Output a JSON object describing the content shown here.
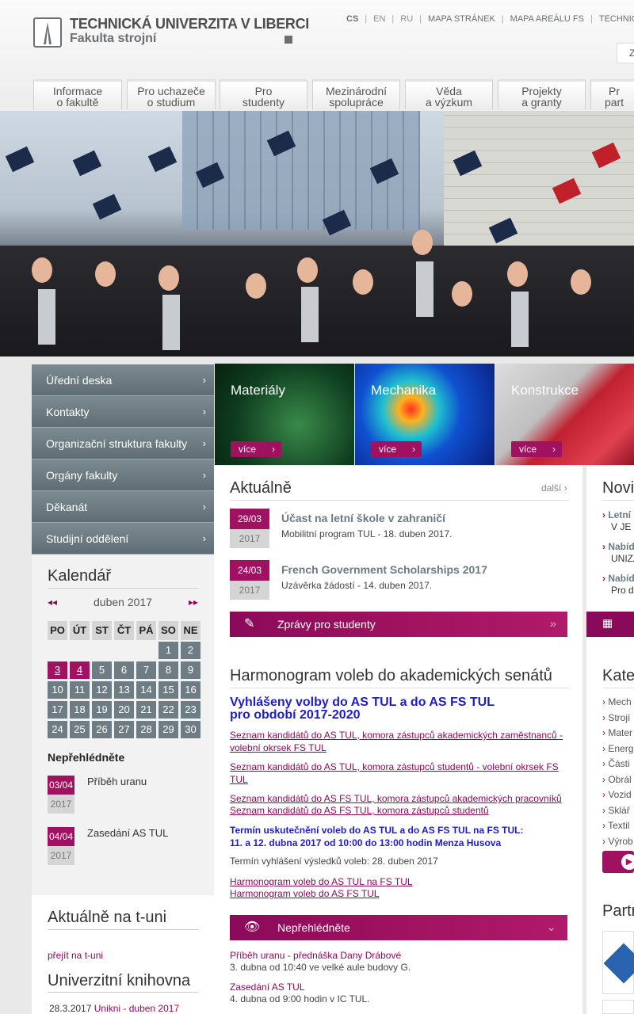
{
  "header": {
    "university": "TECHNICKÁ UNIVERZITA V LIBERCI",
    "faculty": "Fakulta strojní",
    "languages": [
      "CS",
      "EN",
      "RU"
    ],
    "links": [
      "MAPA STRÁNEK",
      "MAPA AREÁLU FS",
      "TECHNICKÁ"
    ],
    "search_partial": "Z"
  },
  "nav": {
    "tabs": [
      {
        "l1": "Informace",
        "l2": "o fakultě"
      },
      {
        "l1": "Pro uchazeče",
        "l2": "o studium"
      },
      {
        "l1": "Pro",
        "l2": "studenty"
      },
      {
        "l1": "Mezinárodní",
        "l2": "spolupráce"
      },
      {
        "l1": "Věda",
        "l2": "a výzkum"
      },
      {
        "l1": "Projekty",
        "l2": "a granty"
      },
      {
        "l1": "Pr",
        "l2": "part"
      }
    ]
  },
  "left_menu": [
    "Úřední deska",
    "Kontakty",
    "Organizační struktura fakulty",
    "Orgány fakulty",
    "Děkanát",
    "Studijní oddělení"
  ],
  "calendar": {
    "title": "Kalendář",
    "month": "duben 2017",
    "prev": "◂◂",
    "next": "▸▸",
    "weekdays": [
      "PO",
      "ÚT",
      "ST",
      "ČT",
      "PÁ",
      "SO",
      "NE"
    ],
    "first_weekday_index": 5,
    "days_in_month": 30,
    "event_days": [
      3,
      4
    ]
  },
  "neprehlednete": {
    "title": "Nepřehlédněte",
    "items": [
      {
        "date": "03/04",
        "year": "2017",
        "text": "Příběh uranu"
      },
      {
        "date": "04/04",
        "year": "2017",
        "text": "Zasedání AS TUL"
      }
    ]
  },
  "tuni": {
    "title": "Aktuálně na t-uni",
    "link": "přejít na t-uni"
  },
  "library": {
    "title": "Univerzitní knihovna",
    "item_date": "28.3.2017",
    "item_link": "Unikni - duben 2017"
  },
  "tiles": [
    {
      "name": "Materiály",
      "more": "více"
    },
    {
      "name": "Mechanika",
      "more": "více"
    },
    {
      "name": "Konstrukce",
      "more": "více"
    }
  ],
  "aktualne": {
    "title": "Aktuálně",
    "more": "další ›",
    "items": [
      {
        "date": "29/03",
        "year": "2017",
        "title": "Účast na letní škole v zahraničí",
        "sub": "Mobilitní program TUL - 18. duben 2017."
      },
      {
        "date": "24/03",
        "year": "2017",
        "title": "French Government Scholarships 2017",
        "sub": "Uzávěrka žádostí - 14. duben 2017."
      }
    ],
    "bar": "Zprávy pro studenty"
  },
  "harmonogram": {
    "title": "Harmonogram voleb do akademických senátů",
    "headline1": "Vyhlášeny volby do AS TUL a do AS FS TUL",
    "headline2": "pro období 2017-2020",
    "link1": "Seznam kandidátů do AS TUL, komora zástupců akademických zaměstnanců - volební okrsek FS TUL",
    "link2": "Seznam kandidátů do AS TUL, komora zástupců studentů - volební okrsek FS TUL",
    "link3": "Seznam kandidátů do AS FS TUL, komora zástupců akademických pracovníků",
    "link4": "Seznam kandidátů do AS FS TUL, komora zástupců studentů",
    "term1": "Termín uskutečnění voleb do AS TUL a do AS FS TUL na FS TUL:",
    "term2": "11. a 12. dubna 2017 od 10:00 do 13:00 hodin Menza Husova",
    "results": "Termín vyhlášení výsledků voleb: 28. duben 2017",
    "link5": "Harmonogram voleb do AS TUL na FS TUL",
    "link6": "Harmonogram voleb do AS FS TUL"
  },
  "nepr_bar": "Nepřehlédněte",
  "nepr_list": [
    {
      "link": "Příběh uranu - přednáška Dany Drábové",
      "sub": "3. dubna od 10:40 ve velké aule budovy G."
    },
    {
      "link": "Zasedání AS TUL",
      "sub": "4. dubna od 9:00 hodin v IC TUL."
    }
  ],
  "right": {
    "novinky_title": "Novir",
    "news": [
      {
        "t": "Letní",
        "s": "V JE T"
      },
      {
        "t": "Nabíd",
        "s": "UNIZA"
      },
      {
        "t": "Nabíd",
        "s": "Pro d"
      }
    ],
    "kat_title": "Kate",
    "kat_items": [
      "Mech",
      "Strojí",
      "Mater",
      "Energ",
      "Části",
      "Obrál",
      "Vozid",
      "Sklář",
      "Textil",
      "Výrob"
    ],
    "partner_title": "Partr"
  },
  "colors": {
    "accent": "#a0125f",
    "menu": "#6e7d83"
  }
}
